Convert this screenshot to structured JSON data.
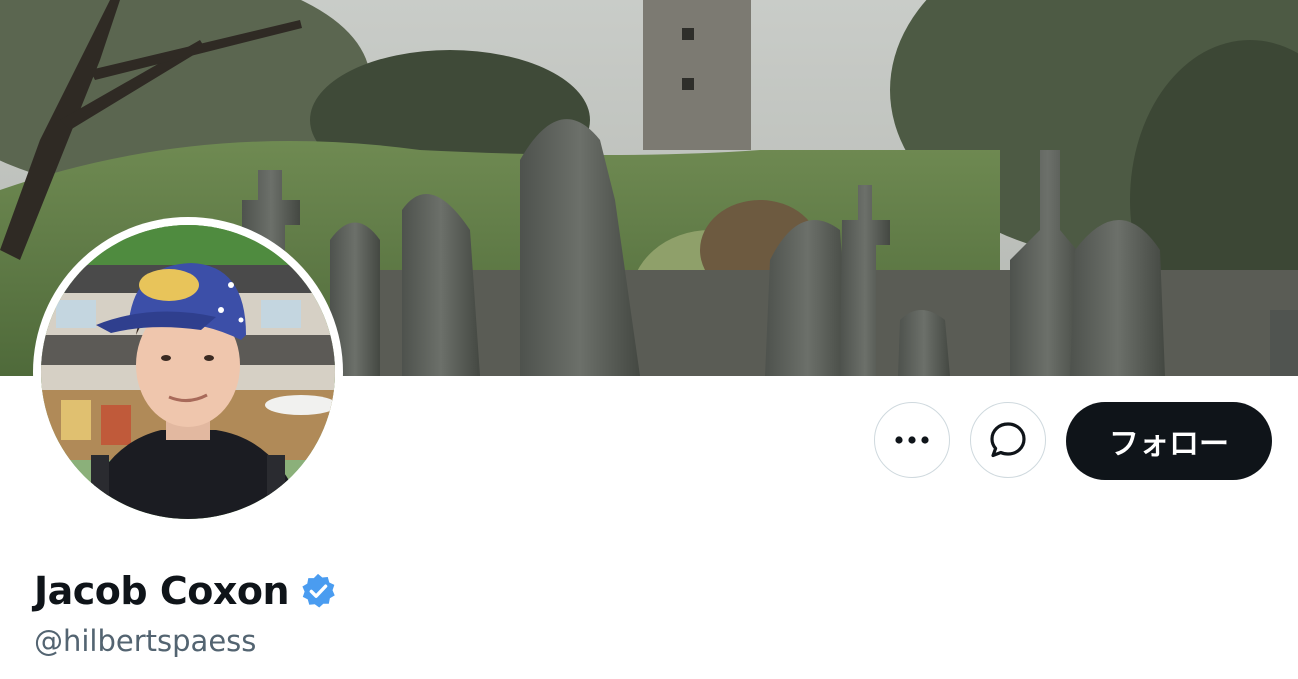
{
  "profile": {
    "display_name": "Jacob Coxon",
    "handle": "@hilbertspaess",
    "verified": true
  },
  "actions": {
    "more_icon": "ellipsis-icon",
    "message_icon": "message-bubble-icon",
    "follow_label": "フォロー"
  },
  "colors": {
    "follow_bg": "#0f1419",
    "verified_blue": "#4a9cf0",
    "handle_gray": "#536471",
    "button_border": "#cfd9de"
  },
  "banner": {
    "image_icon": "graveyard-banner-image"
  },
  "avatar": {
    "image_icon": "profile-photo"
  }
}
